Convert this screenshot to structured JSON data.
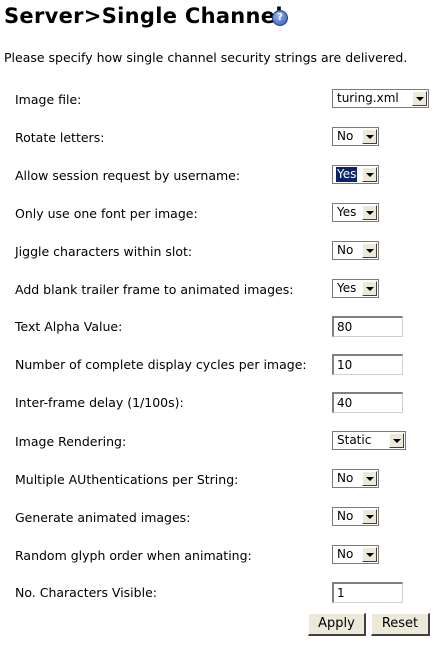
{
  "header": {
    "title": "Server>Single Channel",
    "help_icon": "help-icon",
    "intro": "Please specify how single channel security strings are delivered."
  },
  "settings": [
    {
      "label": "Image file:",
      "kind": "select",
      "value": "turing.xml"
    },
    {
      "label": "Rotate letters:",
      "kind": "select",
      "value": "No"
    },
    {
      "label": "Allow session request by username:",
      "kind": "select",
      "value": "Yes",
      "focused": true
    },
    {
      "label": "Only use one font per image:",
      "kind": "select",
      "value": "Yes"
    },
    {
      "label": "Jiggle characters within slot:",
      "kind": "select",
      "value": "No"
    },
    {
      "label": "Add blank trailer frame to animated images:",
      "kind": "select",
      "value": "Yes"
    },
    {
      "label": "Text Alpha Value:",
      "kind": "input",
      "value": "80"
    },
    {
      "label": "Number of complete display cycles per image:",
      "kind": "input",
      "value": "10"
    },
    {
      "label": "Inter-frame delay (1/100s):",
      "kind": "input",
      "value": "40"
    },
    {
      "label": "Image Rendering:",
      "kind": "select",
      "value": "Static"
    },
    {
      "label": "Multiple AUthentications per String:",
      "kind": "select",
      "value": "No"
    },
    {
      "label": "Generate animated images:",
      "kind": "select",
      "value": "No"
    },
    {
      "label": "Random glyph order when animating:",
      "kind": "select",
      "value": "No"
    },
    {
      "label": "No. Characters Visible:",
      "kind": "input",
      "value": "1"
    }
  ],
  "buttons": {
    "apply": "Apply",
    "reset": "Reset"
  }
}
